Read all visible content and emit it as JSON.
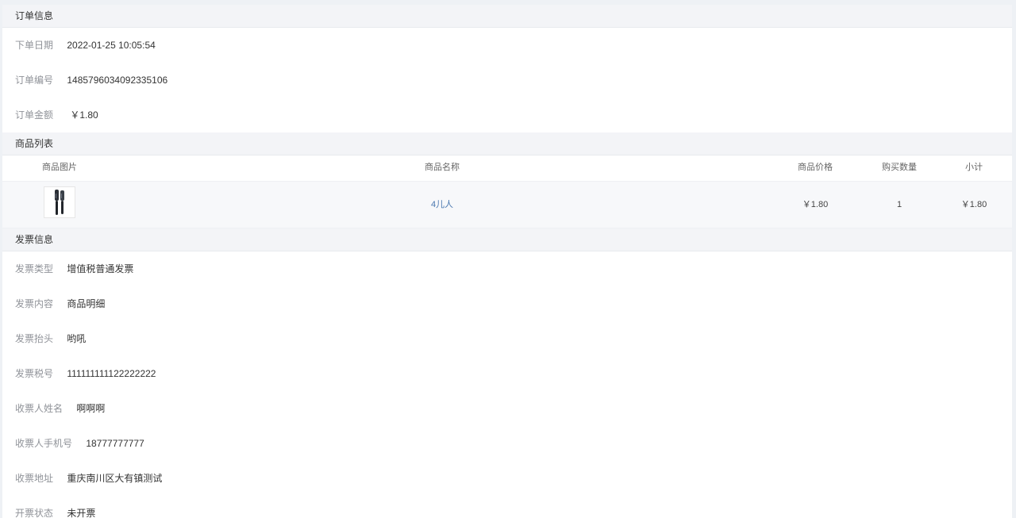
{
  "order_section": {
    "title": "订单信息",
    "fields": [
      {
        "label": "下单日期",
        "value": "2022-01-25 10:05:54"
      },
      {
        "label": "订单编号",
        "value": "1485796034092335106"
      },
      {
        "label": "订单金额",
        "value": "￥1.80"
      }
    ]
  },
  "product_section": {
    "title": "商品列表",
    "columns": [
      "商品图片",
      "商品名称",
      "商品价格",
      "购买数量",
      "小计"
    ],
    "rows": [
      {
        "image_icon": "product-thumbnail",
        "name": "4儿人",
        "price": "￥1.80",
        "qty": "1",
        "subtotal": "￥1.80"
      }
    ]
  },
  "invoice_section": {
    "title": "发票信息",
    "fields": [
      {
        "label": "发票类型",
        "value": "增值税普通发票"
      },
      {
        "label": "发票内容",
        "value": "商品明细"
      },
      {
        "label": "发票抬头",
        "value": "哟吼"
      },
      {
        "label": "发票税号",
        "value": "111111111122222222"
      },
      {
        "label": "收票人姓名",
        "value": "啊啊啊"
      },
      {
        "label": "收票人手机号",
        "value": "18777777777"
      },
      {
        "label": "收票地址",
        "value": "重庆南川区大有镇测试"
      },
      {
        "label": "开票状态",
        "value": "未开票"
      }
    ]
  }
}
